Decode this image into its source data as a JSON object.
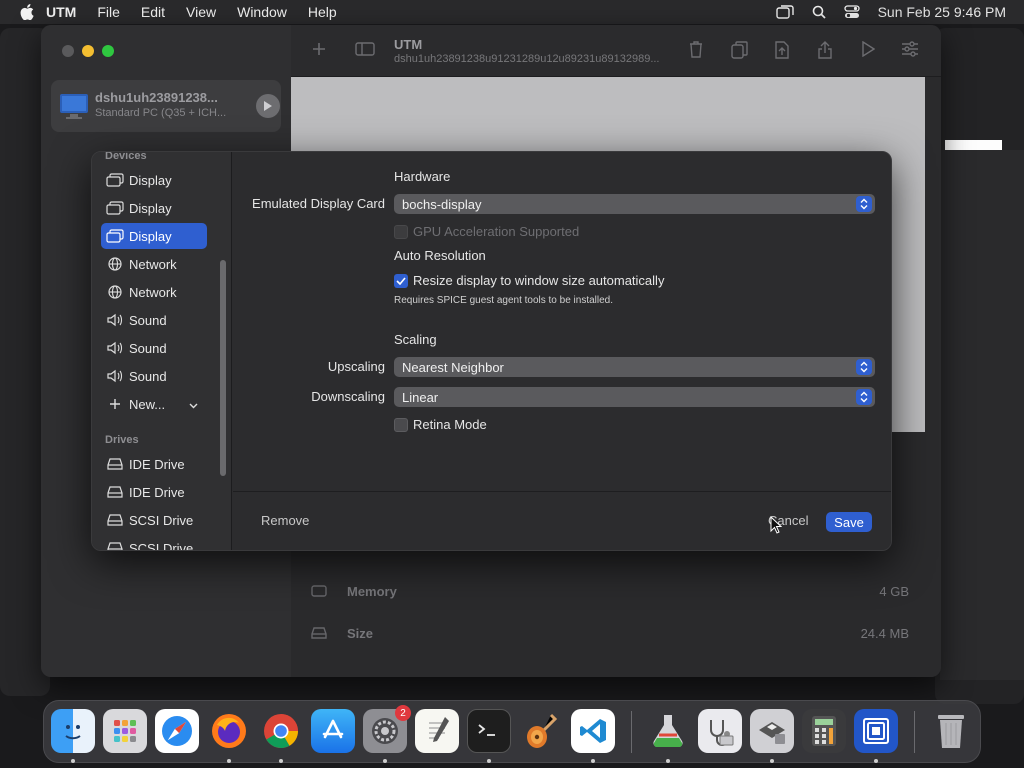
{
  "menubar": {
    "app": "UTM",
    "items": [
      "File",
      "Edit",
      "View",
      "Window",
      "Help"
    ],
    "clock": "Sun Feb 25  9:46 PM"
  },
  "vm": {
    "name": "dshu1uh23891238...",
    "subtitle": "Standard PC (Q35 + ICH...",
    "toolbar_title": "UTM",
    "toolbar_subtitle": "dshu1uh23891238u91231289u12u89231u89132989..."
  },
  "details": {
    "memory_label": "Memory",
    "memory_value": "4 GB",
    "size_label": "Size",
    "size_value": "24.4 MB"
  },
  "dialog": {
    "sidebar": {
      "devices_header": "Devices",
      "devices": [
        {
          "label": "Display",
          "icon": "display-icon"
        },
        {
          "label": "Display",
          "icon": "display-icon"
        },
        {
          "label": "Display",
          "icon": "display-icon",
          "selected": true
        },
        {
          "label": "Network",
          "icon": "globe-icon"
        },
        {
          "label": "Network",
          "icon": "globe-icon"
        },
        {
          "label": "Sound",
          "icon": "speaker-icon"
        },
        {
          "label": "Sound",
          "icon": "speaker-icon"
        },
        {
          "label": "Sound",
          "icon": "speaker-icon"
        }
      ],
      "new_label": "New...",
      "drives_header": "Drives",
      "drives": [
        {
          "label": "IDE Drive",
          "icon": "drive-icon"
        },
        {
          "label": "IDE Drive",
          "icon": "drive-icon"
        },
        {
          "label": "SCSI Drive",
          "icon": "drive-icon"
        },
        {
          "label": "SCSI Drive",
          "icon": "drive-icon"
        }
      ]
    },
    "hardware_heading": "Hardware",
    "display_card_label": "Emulated Display Card",
    "display_card_value": "bochs-display",
    "gpu_accel_label": "GPU Acceleration Supported",
    "gpu_accel_checked": false,
    "auto_res_heading": "Auto Resolution",
    "resize_label": "Resize display to window size automatically",
    "resize_checked": true,
    "resize_note": "Requires SPICE guest agent tools to be installed.",
    "scaling_heading": "Scaling",
    "upscaling_label": "Upscaling",
    "upscaling_value": "Nearest Neighbor",
    "downscaling_label": "Downscaling",
    "downscaling_value": "Linear",
    "retina_label": "Retina Mode",
    "retina_checked": false,
    "remove_label": "Remove",
    "cancel_label": "Cancel",
    "save_label": "Save"
  },
  "dock": {
    "apps": [
      "Finder",
      "Launchpad",
      "Safari",
      "Firefox",
      "Chrome",
      "App Store",
      "System Settings",
      "TextEdit",
      "Terminal",
      "GarageBand",
      "VS Code",
      "Disk Utility",
      "System Information",
      "Boot Camp",
      "Calculator",
      "UTM",
      "Trash"
    ],
    "settings_badge": "2"
  },
  "colors": {
    "accent": "#2f5fd0",
    "window_bg": "#2c2c2e",
    "sidebar_bg": "#303032"
  }
}
